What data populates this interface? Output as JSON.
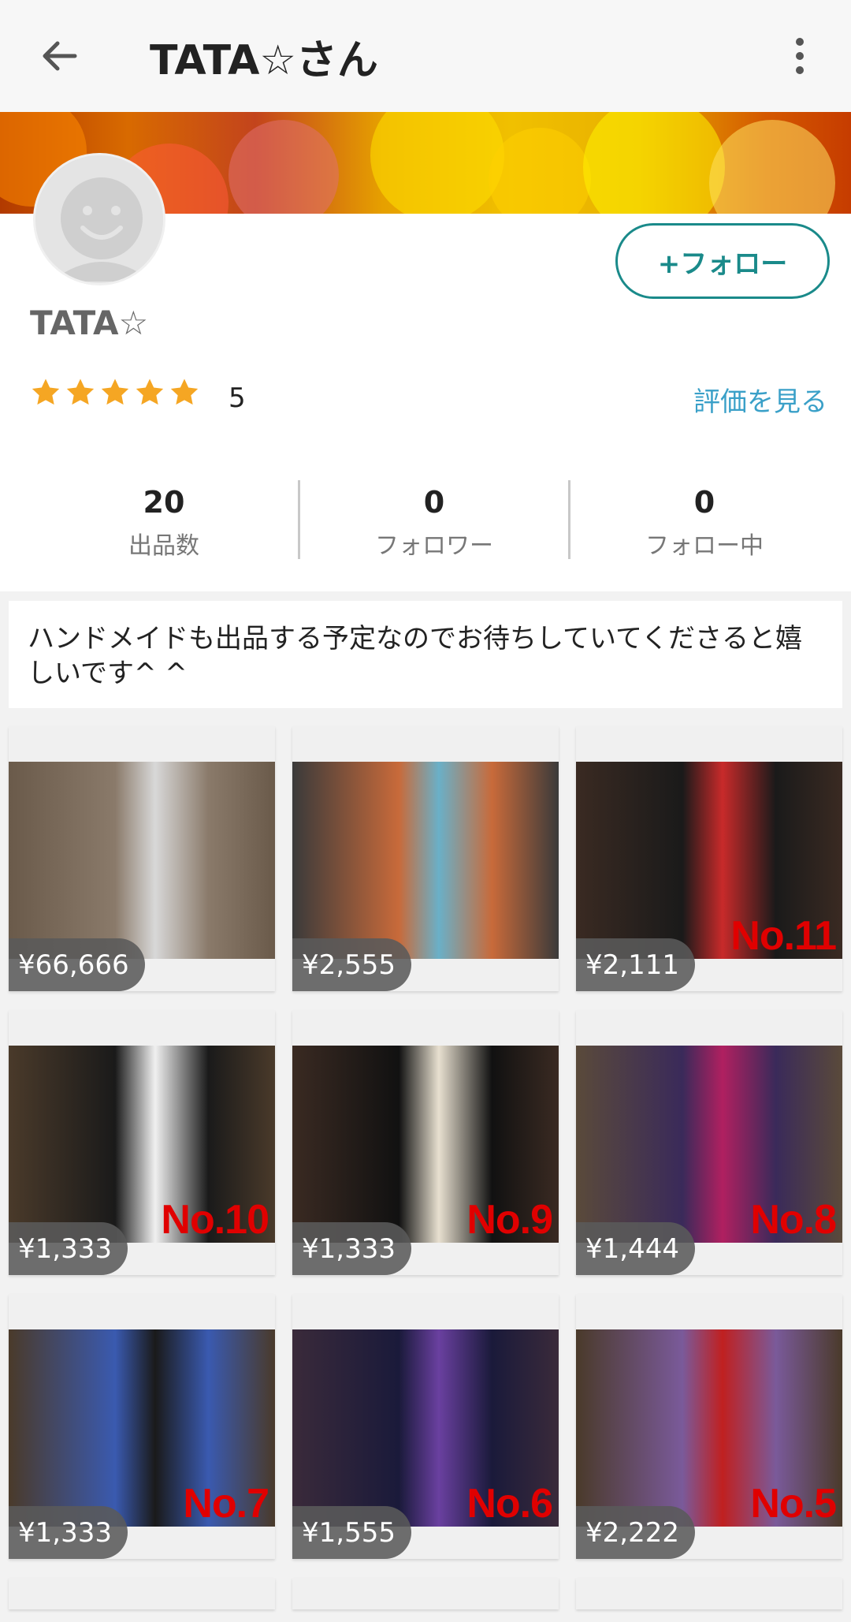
{
  "appbar": {
    "title": "TATA☆さん",
    "back_icon": "arrow-back-icon",
    "more_icon": "more-vertical-icon"
  },
  "profile": {
    "username": "TATA☆",
    "follow_label": "+フォロー",
    "rating": 5,
    "rating_label": "5",
    "see_reviews": "評価を見る",
    "stats": [
      {
        "num": "20",
        "label": "出品数"
      },
      {
        "num": "0",
        "label": "フォロワー"
      },
      {
        "num": "0",
        "label": "フォロー中"
      }
    ]
  },
  "bio": "ハンドメイドも出品する予定なのでお待ちしていてくださると嬉しいです^ ^",
  "colors": {
    "accent": "#1a8a8a",
    "link": "#3aa0c8",
    "star": "#f5a623",
    "badge": "#e00000"
  },
  "items": [
    {
      "price": "¥66,666",
      "badge": ""
    },
    {
      "price": "¥2,555",
      "badge": ""
    },
    {
      "price": "¥2,111",
      "badge": "No.11"
    },
    {
      "price": "¥1,333",
      "badge": "No.10"
    },
    {
      "price": "¥1,333",
      "badge": "No.9"
    },
    {
      "price": "¥1,444",
      "badge": "No.8"
    },
    {
      "price": "¥1,333",
      "badge": "No.7"
    },
    {
      "price": "¥1,555",
      "badge": "No.6"
    },
    {
      "price": "¥2,222",
      "badge": "No.5"
    }
  ]
}
